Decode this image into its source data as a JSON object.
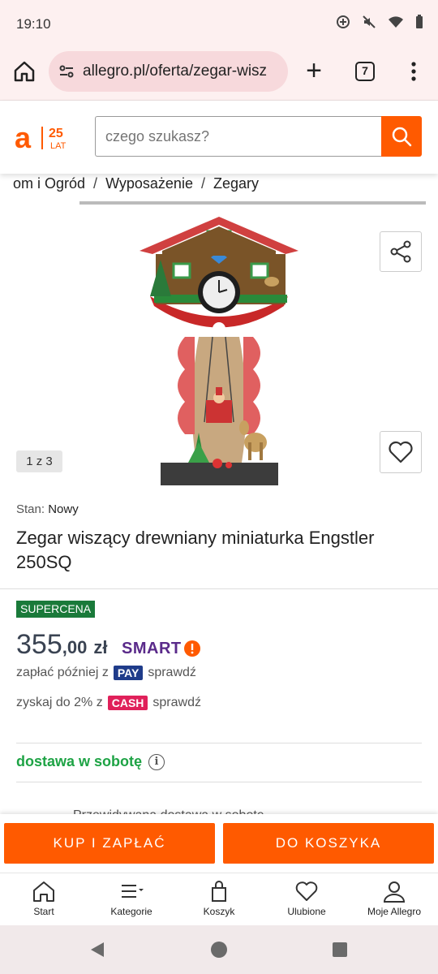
{
  "status_bar": {
    "time": "19:10"
  },
  "browser": {
    "url": "allegro.pl/oferta/zegar-wisz",
    "tab_count": "7"
  },
  "header": {
    "logo": {
      "letter": "a",
      "badge_number": "25",
      "badge_word": "LAT"
    },
    "search": {
      "placeholder": "czego szukasz?"
    }
  },
  "breadcrumb": [
    "om i Ogród",
    "Wyposażenie",
    "Zegary"
  ],
  "gallery": {
    "counter": "1 z 3"
  },
  "product": {
    "condition_label": "Stan:",
    "condition_value": "Nowy",
    "title": "Zegar wiszący drewniany miniaturka Engstler 250SQ",
    "badge": "SUPERCENA",
    "price_int": "355",
    "price_dec": ",00",
    "currency": "zł",
    "smart_label": "SMART"
  },
  "pay_later": {
    "text": "zapłać później z",
    "badge": "PAY",
    "link": "sprawdź"
  },
  "cash_back": {
    "text": "zyskaj do 2% z",
    "badge": "CASH",
    "link": "sprawdź"
  },
  "delivery": {
    "text": "dostawa w sobotę"
  },
  "peek": {
    "text": "Przewidywana dostawa w sobotę"
  },
  "actions": {
    "buy": "KUP I ZAPŁAĆ",
    "cart": "DO KOSZYKA"
  },
  "bottom_nav": [
    {
      "label": "Start",
      "icon": "home-icon"
    },
    {
      "label": "Kategorie",
      "icon": "categories-icon"
    },
    {
      "label": "Koszyk",
      "icon": "cart-icon"
    },
    {
      "label": "Ulubione",
      "icon": "heart-icon"
    },
    {
      "label": "Moje Allegro",
      "icon": "user-icon"
    }
  ],
  "colors": {
    "brand": "#ff5a00",
    "delivery": "#1ea345",
    "supercena": "#1a7a3a",
    "smart": "#5a2a8a"
  }
}
